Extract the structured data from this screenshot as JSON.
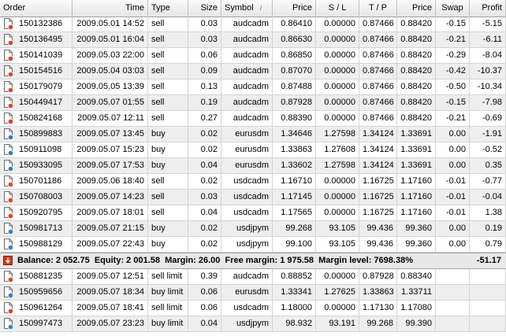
{
  "columns": [
    {
      "key": "order",
      "label": "Order",
      "align": "l"
    },
    {
      "key": "time",
      "label": "Time",
      "align": "r"
    },
    {
      "key": "type",
      "label": "Type",
      "align": "l"
    },
    {
      "key": "size",
      "label": "Size",
      "align": "r"
    },
    {
      "key": "symbol",
      "label": "Symbol",
      "align": "l",
      "sort": "/"
    },
    {
      "key": "price",
      "label": "Price",
      "align": "r"
    },
    {
      "key": "sl",
      "label": "S / L",
      "align": "c"
    },
    {
      "key": "tp",
      "label": "T / P",
      "align": "c"
    },
    {
      "key": "cur_price",
      "label": "Price",
      "align": "r"
    },
    {
      "key": "swap",
      "label": "Swap",
      "align": "c"
    },
    {
      "key": "profit",
      "label": "Profit",
      "align": "r"
    }
  ],
  "trades": [
    {
      "order": "150132386",
      "time": "2009.05.01 14:52",
      "type": "sell",
      "size": "0.03",
      "symbol": "audcadm",
      "price": "0.86410",
      "sl": "0.00000",
      "tp": "0.87466",
      "cur_price": "0.88420",
      "swap": "-0.15",
      "profit": "-5.15",
      "icon": "sell"
    },
    {
      "order": "150136495",
      "time": "2009.05.01 16:04",
      "type": "sell",
      "size": "0.03",
      "symbol": "audcadm",
      "price": "0.86630",
      "sl": "0.00000",
      "tp": "0.87466",
      "cur_price": "0.88420",
      "swap": "-0.21",
      "profit": "-6.11",
      "icon": "sell"
    },
    {
      "order": "150141039",
      "time": "2009.05.03 22:00",
      "type": "sell",
      "size": "0.06",
      "symbol": "audcadm",
      "price": "0.86850",
      "sl": "0.00000",
      "tp": "0.87466",
      "cur_price": "0.88420",
      "swap": "-0.29",
      "profit": "-8.04",
      "icon": "sell"
    },
    {
      "order": "150154516",
      "time": "2009.05.04 03:03",
      "type": "sell",
      "size": "0.09",
      "symbol": "audcadm",
      "price": "0.87070",
      "sl": "0.00000",
      "tp": "0.87466",
      "cur_price": "0.88420",
      "swap": "-0.42",
      "profit": "-10.37",
      "icon": "sell"
    },
    {
      "order": "150179079",
      "time": "2009.05.05 13:39",
      "type": "sell",
      "size": "0.13",
      "symbol": "audcadm",
      "price": "0.87488",
      "sl": "0.00000",
      "tp": "0.87466",
      "cur_price": "0.88420",
      "swap": "-0.50",
      "profit": "-10.34",
      "icon": "sell"
    },
    {
      "order": "150449417",
      "time": "2009.05.07 01:55",
      "type": "sell",
      "size": "0.19",
      "symbol": "audcadm",
      "price": "0.87928",
      "sl": "0.00000",
      "tp": "0.87466",
      "cur_price": "0.88420",
      "swap": "-0.15",
      "profit": "-7.98",
      "icon": "sell"
    },
    {
      "order": "150824168",
      "time": "2009.05.07 12:11",
      "type": "sell",
      "size": "0.27",
      "symbol": "audcadm",
      "price": "0.88390",
      "sl": "0.00000",
      "tp": "0.87466",
      "cur_price": "0.88420",
      "swap": "-0.21",
      "profit": "-0.69",
      "icon": "sell"
    },
    {
      "order": "150899883",
      "time": "2009.05.07 13:45",
      "type": "buy",
      "size": "0.02",
      "symbol": "eurusdm",
      "price": "1.34646",
      "sl": "1.27598",
      "tp": "1.34124",
      "cur_price": "1.33691",
      "swap": "0.00",
      "profit": "-1.91",
      "icon": "buy"
    },
    {
      "order": "150911098",
      "time": "2009.05.07 15:23",
      "type": "buy",
      "size": "0.02",
      "symbol": "eurusdm",
      "price": "1.33863",
      "sl": "1.27608",
      "tp": "1.34124",
      "cur_price": "1.33691",
      "swap": "0.00",
      "profit": "-0.52",
      "icon": "buy"
    },
    {
      "order": "150933095",
      "time": "2009.05.07 17:53",
      "type": "buy",
      "size": "0.04",
      "symbol": "eurusdm",
      "price": "1.33602",
      "sl": "1.27598",
      "tp": "1.34124",
      "cur_price": "1.33691",
      "swap": "0.00",
      "profit": "0.35",
      "icon": "buy"
    },
    {
      "order": "150701186",
      "time": "2009.05.06 18:40",
      "type": "sell",
      "size": "0.02",
      "symbol": "usdcadm",
      "price": "1.16710",
      "sl": "0.00000",
      "tp": "1.16725",
      "cur_price": "1.17160",
      "swap": "-0.01",
      "profit": "-0.77",
      "icon": "sell"
    },
    {
      "order": "150708003",
      "time": "2009.05.07 14:23",
      "type": "sell",
      "size": "0.03",
      "symbol": "usdcadm",
      "price": "1.17145",
      "sl": "0.00000",
      "tp": "1.16725",
      "cur_price": "1.17160",
      "swap": "-0.01",
      "profit": "-0.04",
      "icon": "sell"
    },
    {
      "order": "150920795",
      "time": "2009.05.07 18:01",
      "type": "sell",
      "size": "0.04",
      "symbol": "usdcadm",
      "price": "1.17565",
      "sl": "0.00000",
      "tp": "1.16725",
      "cur_price": "1.17160",
      "swap": "-0.01",
      "profit": "1.38",
      "icon": "sell"
    },
    {
      "order": "150981713",
      "time": "2009.05.07 21:15",
      "type": "buy",
      "size": "0.02",
      "symbol": "usdjpym",
      "price": "99.268",
      "sl": "93.105",
      "tp": "99.436",
      "cur_price": "99.360",
      "swap": "0.00",
      "profit": "0.19",
      "icon": "buy"
    },
    {
      "order": "150988129",
      "time": "2009.05.07 22:43",
      "type": "buy",
      "size": "0.02",
      "symbol": "usdjpym",
      "price": "99.100",
      "sl": "93.105",
      "tp": "99.436",
      "cur_price": "99.360",
      "swap": "0.00",
      "profit": "0.79",
      "icon": "buy"
    }
  ],
  "balance": {
    "text": "Balance: 2 052.75  Equity: 2 001.58  Margin: 26.00  Free margin: 1 975.58  Margin level: 7698.38%",
    "profit": "-51.17"
  },
  "pending": [
    {
      "order": "150881235",
      "time": "2009.05.07 12:51",
      "type": "sell limit",
      "size": "0.39",
      "symbol": "audcadm",
      "price": "0.88852",
      "sl": "0.00000",
      "tp": "0.87928",
      "cur_price": "0.88340",
      "swap": "",
      "profit": "",
      "icon": "sell"
    },
    {
      "order": "150959656",
      "time": "2009.05.07 18:34",
      "type": "buy limit",
      "size": "0.06",
      "symbol": "eurusdm",
      "price": "1.33341",
      "sl": "1.27625",
      "tp": "1.33863",
      "cur_price": "1.33711",
      "swap": "",
      "profit": "",
      "icon": "buy"
    },
    {
      "order": "150961264",
      "time": "2009.05.07 18:41",
      "type": "sell limit",
      "size": "0.06",
      "symbol": "usdcadm",
      "price": "1.18000",
      "sl": "0.00000",
      "tp": "1.17130",
      "cur_price": "1.17080",
      "swap": "",
      "profit": "",
      "icon": "sell"
    },
    {
      "order": "150997473",
      "time": "2009.05.07 23:23",
      "type": "buy limit",
      "size": "0.04",
      "symbol": "usdjpym",
      "price": "98.932",
      "sl": "93.191",
      "tp": "99.268",
      "cur_price": "99.390",
      "swap": "",
      "profit": "",
      "icon": "buy"
    }
  ],
  "colors": {
    "sell_dot": "#e8401c",
    "buy_dot": "#2a7fd4",
    "balance_icon": "#d43a1a"
  },
  "icons": {
    "order": "document-icon",
    "balance": "balance-arrow-icon"
  }
}
